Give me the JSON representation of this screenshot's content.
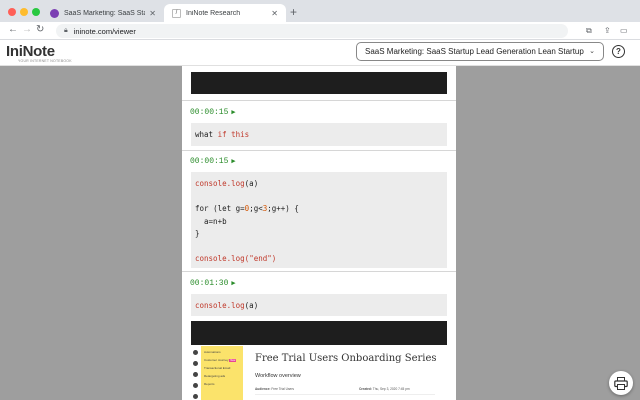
{
  "browser": {
    "tabs": [
      {
        "title": "SaaS Marketing: SaaS Startup",
        "active": false
      },
      {
        "title": "IniNote Research",
        "active": true
      }
    ],
    "url": "ininote.com/viewer"
  },
  "app": {
    "logo_text": "IniNote",
    "logo_tagline": "YOUR INTERNET NOTEBOOK",
    "notebook_selected": "SaaS Marketing: SaaS Startup Lead Generation Lean Startup",
    "help_label": "?"
  },
  "entries": [
    {
      "timestamp": "00:00:15"
    },
    {
      "timestamp": "00:00:15"
    },
    {
      "timestamp": "00:01:30"
    }
  ],
  "code": {
    "block1": {
      "w1": "what",
      "w2": "if",
      "w3": "this"
    },
    "block2": {
      "l1_obj": "console",
      "l1_fn": ".log",
      "l1_arg": "(a)",
      "l2_for": "for",
      "l2_let": "(let",
      "l2_g": "g=",
      "l2_zero": "0",
      "l2_mid": ";g<",
      "l2_three": "3",
      "l2_end": ";g++) {",
      "l3": "  a=n+b",
      "l4": "}",
      "l5_obj": "console",
      "l5_fn": ".log(",
      "l5_str": "\"end\"",
      "l5_close": ")"
    },
    "block3": {
      "obj": "console",
      "fn": ".log",
      "arg": "(a)"
    }
  },
  "embedded_screenshot": {
    "sidebar_items": [
      "Automations",
      "Customer Journey",
      "Transactional Email",
      "Retargeting ads",
      "Reports"
    ],
    "badge": "New",
    "heading": "Free Trial Users Onboarding Series",
    "subheading": "Workflow overview",
    "audience_label": "Audience:",
    "audience_value": "Free Trial Users",
    "created_label": "Created:",
    "created_value": "Thu, Sep 3, 2020 7:45 pm"
  }
}
